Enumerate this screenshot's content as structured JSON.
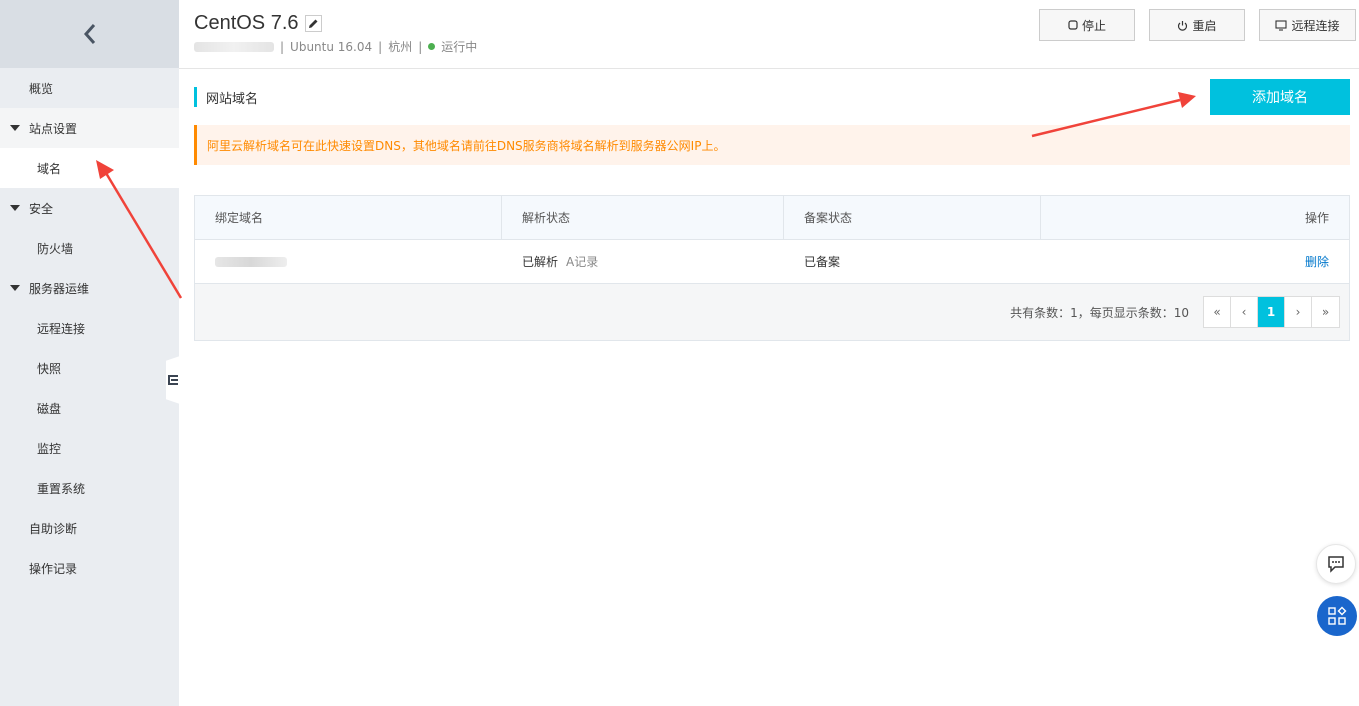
{
  "sidebar": {
    "items": [
      {
        "label": "概览"
      },
      {
        "label": "站点设置"
      },
      {
        "label": "域名"
      },
      {
        "label": "安全"
      },
      {
        "label": "防火墙"
      },
      {
        "label": "服务器运维"
      },
      {
        "label": "远程连接"
      },
      {
        "label": "快照"
      },
      {
        "label": "磁盘"
      },
      {
        "label": "监控"
      },
      {
        "label": "重置系统"
      },
      {
        "label": "自助诊断"
      },
      {
        "label": "操作记录"
      }
    ]
  },
  "header": {
    "title": "CentOS 7.6",
    "os": "Ubuntu 16.04",
    "region": "杭州",
    "status": "运行中",
    "status_color": "#4caf50",
    "buttons": {
      "stop": "停止",
      "restart": "重启",
      "remote": "远程连接"
    }
  },
  "main": {
    "section_title": "网站域名",
    "add_button": "添加域名",
    "notice": "阿里云解析域名可在此快速设置DNS，其他域名请前往DNS服务商将域名解析到服务器公网IP上。",
    "table": {
      "columns": [
        "绑定域名",
        "解析状态",
        "备案状态",
        "操作"
      ],
      "rows": [
        {
          "resolve_status": "已解析",
          "record": "A记录",
          "icp_status": "已备案",
          "action": "删除"
        }
      ],
      "total_text": "共有条数：1，每页显示条数：10",
      "pager": {
        "first": "«",
        "prev": "‹",
        "current": "1",
        "next": "›",
        "last": "»"
      }
    }
  },
  "colors": {
    "accent": "#00c1de",
    "warning": "#ff8a00",
    "annotation": "#f0433a",
    "fab": "#1a66cc"
  }
}
